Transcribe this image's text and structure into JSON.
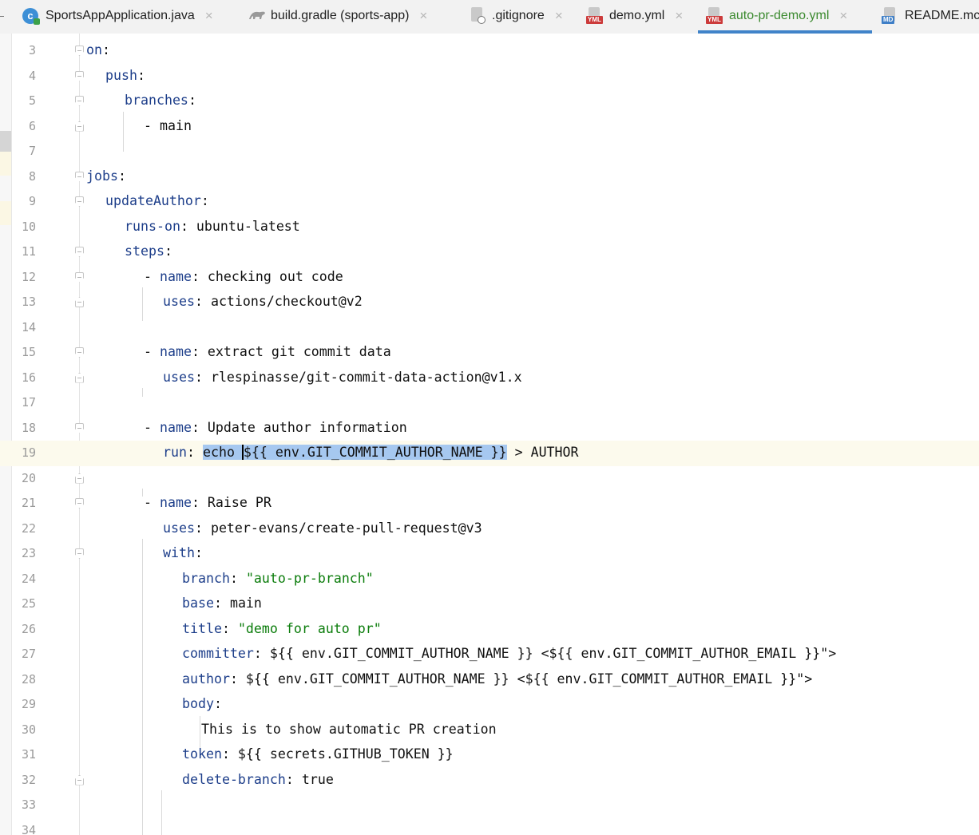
{
  "tabs": [
    {
      "label": "SportsAppApplication.java",
      "icon": "java-class-icon",
      "active": false
    },
    {
      "label": "build.gradle (sports-app)",
      "icon": "gradle-icon",
      "active": false
    },
    {
      "label": ".gitignore",
      "icon": "ignore-file-icon",
      "active": false
    },
    {
      "label": "demo.yml",
      "icon": "yml-file-icon",
      "active": false
    },
    {
      "label": "auto-pr-demo.yml",
      "icon": "yml-file-icon",
      "active": true
    },
    {
      "label": "README.mc",
      "icon": "markdown-file-icon",
      "active": false
    }
  ],
  "tab_close_glyph": "×",
  "editor": {
    "current_line": 19,
    "lines": [
      {
        "n": "3",
        "indent": 0,
        "parts": [
          {
            "t": "on",
            "c": "k"
          },
          {
            "t": ":"
          }
        ]
      },
      {
        "n": "4",
        "indent": 1,
        "parts": [
          {
            "t": "push",
            "c": "k"
          },
          {
            "t": ":"
          }
        ]
      },
      {
        "n": "5",
        "indent": 2,
        "parts": [
          {
            "t": "branches",
            "c": "k"
          },
          {
            "t": ":"
          }
        ]
      },
      {
        "n": "6",
        "indent": 3,
        "parts": [
          {
            "t": "- main"
          }
        ]
      },
      {
        "n": "7",
        "indent": 0,
        "parts": []
      },
      {
        "n": "8",
        "indent": 0,
        "parts": [
          {
            "t": "jobs",
            "c": "k"
          },
          {
            "t": ":"
          }
        ]
      },
      {
        "n": "9",
        "indent": 1,
        "parts": [
          {
            "t": "updateAuthor",
            "c": "k"
          },
          {
            "t": ":"
          }
        ]
      },
      {
        "n": "10",
        "indent": 2,
        "parts": [
          {
            "t": "runs-on",
            "c": "k"
          },
          {
            "t": ": ubuntu-latest"
          }
        ]
      },
      {
        "n": "11",
        "indent": 2,
        "parts": [
          {
            "t": "steps",
            "c": "k"
          },
          {
            "t": ":"
          }
        ]
      },
      {
        "n": "12",
        "indent": 3,
        "parts": [
          {
            "t": "- "
          },
          {
            "t": "name",
            "c": "k"
          },
          {
            "t": ": checking out code"
          }
        ]
      },
      {
        "n": "13",
        "indent": 4,
        "parts": [
          {
            "t": "uses",
            "c": "k"
          },
          {
            "t": ": actions/checkout@v2"
          }
        ]
      },
      {
        "n": "14",
        "indent": 0,
        "parts": []
      },
      {
        "n": "15",
        "indent": 3,
        "parts": [
          {
            "t": "- "
          },
          {
            "t": "name",
            "c": "k"
          },
          {
            "t": ": extract git commit data"
          }
        ]
      },
      {
        "n": "16",
        "indent": 4,
        "parts": [
          {
            "t": "uses",
            "c": "k"
          },
          {
            "t": ": rlespinasse/git-commit-data-action@v1.x"
          }
        ]
      },
      {
        "n": "17",
        "indent": 0,
        "parts": []
      },
      {
        "n": "18",
        "indent": 3,
        "parts": [
          {
            "t": "- "
          },
          {
            "t": "name",
            "c": "k"
          },
          {
            "t": ": Update author information"
          }
        ]
      },
      {
        "n": "19",
        "indent": 4,
        "parts": [
          {
            "t": "run",
            "c": "k"
          },
          {
            "t": ": "
          },
          {
            "t": "echo ",
            "c": "sel"
          },
          {
            "t": "${{ env.GIT_COMMIT_AUTHOR_NAME }}",
            "c": "sel caret"
          },
          {
            "t": " > AUTHOR"
          }
        ]
      },
      {
        "n": "20",
        "indent": 0,
        "parts": []
      },
      {
        "n": "21",
        "indent": 3,
        "parts": [
          {
            "t": "- "
          },
          {
            "t": "name",
            "c": "k"
          },
          {
            "t": ": Raise PR"
          }
        ]
      },
      {
        "n": "22",
        "indent": 4,
        "parts": [
          {
            "t": "uses",
            "c": "k"
          },
          {
            "t": ": peter-evans/create-pull-request@v3"
          }
        ]
      },
      {
        "n": "23",
        "indent": 4,
        "parts": [
          {
            "t": "with",
            "c": "k"
          },
          {
            "t": ":"
          }
        ]
      },
      {
        "n": "24",
        "indent": 5,
        "parts": [
          {
            "t": "branch",
            "c": "k"
          },
          {
            "t": ": "
          },
          {
            "t": "\"auto-pr-branch\"",
            "c": "s"
          }
        ]
      },
      {
        "n": "25",
        "indent": 5,
        "parts": [
          {
            "t": "base",
            "c": "k"
          },
          {
            "t": ": main"
          }
        ]
      },
      {
        "n": "26",
        "indent": 5,
        "parts": [
          {
            "t": "title",
            "c": "k"
          },
          {
            "t": ": "
          },
          {
            "t": "\"demo for auto pr\"",
            "c": "s"
          }
        ]
      },
      {
        "n": "27",
        "indent": 5,
        "parts": [
          {
            "t": "committer",
            "c": "k"
          },
          {
            "t": ": ${{ env.GIT_COMMIT_AUTHOR_NAME }} <${{ env.GIT_COMMIT_AUTHOR_EMAIL }}\">"
          }
        ]
      },
      {
        "n": "28",
        "indent": 5,
        "parts": [
          {
            "t": "author",
            "c": "k"
          },
          {
            "t": ": ${{ env.GIT_COMMIT_AUTHOR_NAME }} <${{ env.GIT_COMMIT_AUTHOR_EMAIL }}\">"
          }
        ]
      },
      {
        "n": "29",
        "indent": 5,
        "parts": [
          {
            "t": "body",
            "c": "k"
          },
          {
            "t": ":"
          }
        ]
      },
      {
        "n": "30",
        "indent": 6,
        "parts": [
          {
            "t": "This is to show automatic PR creation"
          }
        ]
      },
      {
        "n": "31",
        "indent": 5,
        "parts": [
          {
            "t": "token",
            "c": "k"
          },
          {
            "t": ": ${{ secrets.GITHUB_TOKEN }}"
          }
        ]
      },
      {
        "n": "32",
        "indent": 5,
        "parts": [
          {
            "t": "delete-branch",
            "c": "k"
          },
          {
            "t": ": true"
          }
        ]
      },
      {
        "n": "33",
        "indent": 0,
        "parts": []
      },
      {
        "n": "34",
        "indent": 0,
        "parts": []
      }
    ]
  },
  "colors": {
    "keyword": "#1d3e8a",
    "string": "#0c7d0c",
    "selection": "#a6c8f0",
    "active_tab_text": "#3b8a2f",
    "active_tab_underline": "#4083c9"
  }
}
